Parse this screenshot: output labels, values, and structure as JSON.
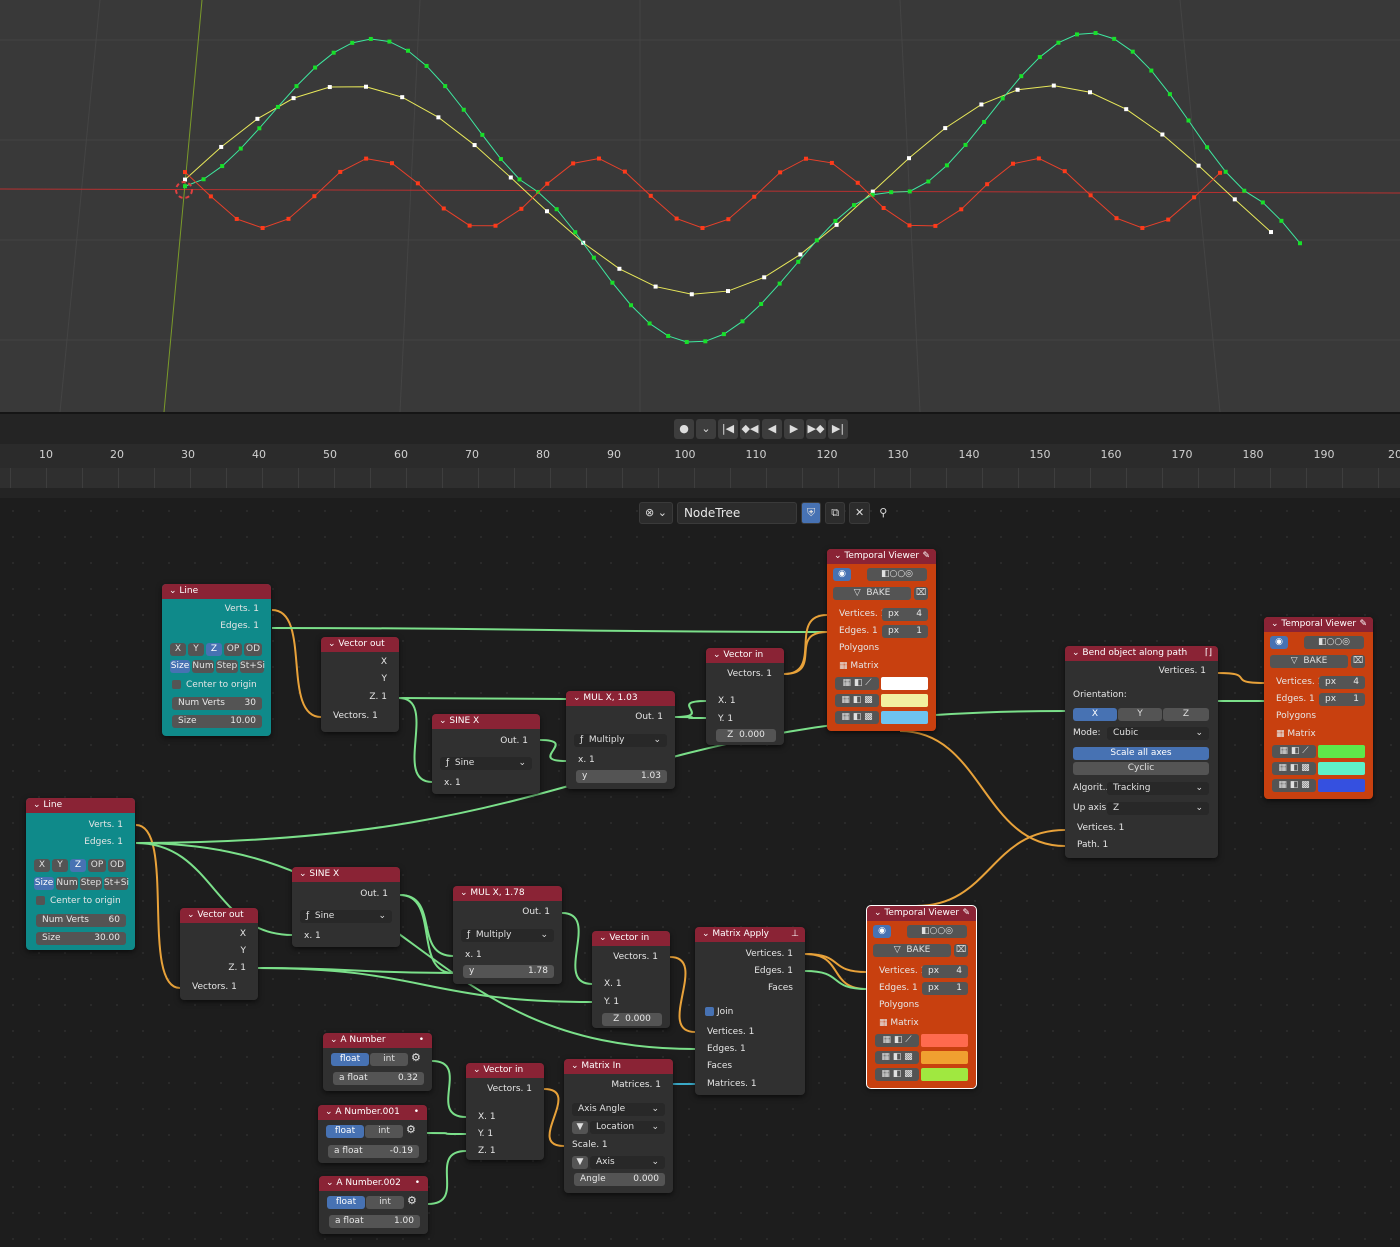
{
  "viewport": {
    "curves": {
      "white_color": "#e8e85a",
      "green_color": "#3ee8a0",
      "red_color": "#e8402a"
    }
  },
  "timeline": {
    "transport": [
      "●",
      "⌄",
      "|◀",
      "◆◀",
      "◀",
      "▶",
      "▶◆",
      "▶|"
    ],
    "frames": [
      "10",
      "20",
      "30",
      "40",
      "50",
      "60",
      "70",
      "80",
      "90",
      "100",
      "110",
      "120",
      "130",
      "140",
      "150",
      "160",
      "170",
      "180",
      "190",
      "20"
    ]
  },
  "node_header": {
    "editor_type": "⊗ ⌄",
    "tree_name": "NodeTree",
    "icons": [
      "shield-icon",
      "copy-icon",
      "close-icon",
      "pin-icon"
    ]
  },
  "nodes": {
    "line1": {
      "title": "Line",
      "verts": "Verts. 1",
      "edges": "Edges. 1",
      "modes": [
        "X",
        "Y",
        "Z",
        "OP",
        "OD"
      ],
      "mode_active": "Z",
      "kinds": [
        "Size",
        "Num",
        "Step",
        "St+Si"
      ],
      "center": "Center to origin",
      "num_verts_label": "Num Verts",
      "num_verts": "30",
      "size_label": "Size",
      "size": "10.00"
    },
    "line2": {
      "title": "Line",
      "verts": "Verts. 1",
      "edges": "Edges. 1",
      "modes": [
        "X",
        "Y",
        "Z",
        "OP",
        "OD"
      ],
      "mode_active": "Z",
      "kinds": [
        "Size",
        "Num",
        "Step",
        "St+Si"
      ],
      "center": "Center to origin",
      "num_verts_label": "Num Verts",
      "num_verts": "60",
      "size_label": "Size",
      "size": "30.00"
    },
    "vout1": {
      "title": "Vector out",
      "x": "X",
      "y": "Y",
      "z": "Z. 1",
      "vectors": "Vectors. 1"
    },
    "vout2": {
      "title": "Vector out",
      "x": "X",
      "y": "Y",
      "z": "Z. 1",
      "vectors": "Vectors. 1"
    },
    "sine1": {
      "title": "SINE X",
      "out": "Out. 1",
      "func": "Sine",
      "x": "x. 1"
    },
    "sine2": {
      "title": "SINE X",
      "out": "Out. 1",
      "func": "Sine",
      "x": "x. 1"
    },
    "mul1": {
      "title": "MUL X, 1.03",
      "out": "Out. 1",
      "func": "Multiply",
      "x": "x. 1",
      "y_label": "y",
      "y": "1.03"
    },
    "mul2": {
      "title": "MUL X, 1.78",
      "out": "Out. 1",
      "func": "Multiply",
      "x": "x. 1",
      "y_label": "y",
      "y": "1.78"
    },
    "vin1": {
      "title": "Vector in",
      "vectors": "Vectors. 1",
      "x": "X. 1",
      "y": "Y. 1",
      "z_label": "Z",
      "z": "0.000"
    },
    "vin2": {
      "title": "Vector in",
      "vectors": "Vectors. 1",
      "x": "X. 1",
      "y": "Y. 1",
      "z_label": "Z",
      "z": "0.000"
    },
    "vin3": {
      "title": "Vector in",
      "vectors": "Vectors. 1",
      "x": "X. 1",
      "y": "Y. 1",
      "z": "Z. 1"
    },
    "tv1": {
      "title": "Temporal Viewer",
      "bake": "BAKE",
      "vertices": "Vertices. 1",
      "edges": "Edges. 1",
      "polygons": "Polygons",
      "matrix": "Matrix",
      "px": "px",
      "vsize": "4",
      "esize": "1",
      "colors": [
        "#ffffff",
        "#f2f0a0",
        "#6ec3f0"
      ]
    },
    "tv2": {
      "title": "Temporal Viewer",
      "bake": "BAKE",
      "vertices": "Vertices. 1",
      "edges": "Edges. 1",
      "polygons": "Polygons",
      "matrix": "Matrix",
      "px": "px",
      "vsize": "4",
      "esize": "1",
      "colors": [
        "#5ee84a",
        "#5ef0c8",
        "#3550e0"
      ]
    },
    "tv3": {
      "title": "Temporal Viewer",
      "bake": "BAKE",
      "vertices": "Vertices. 1",
      "edges": "Edges. 1",
      "polygons": "Polygons",
      "matrix": "Matrix",
      "px": "px",
      "vsize": "4",
      "esize": "1",
      "colors": [
        "#ff6a4e",
        "#f0a030",
        "#a0e840"
      ]
    },
    "bend": {
      "title": "Bend object along path",
      "vertices_out": "Vertices. 1",
      "orientation": "Orientation:",
      "axes": [
        "X",
        "Y",
        "Z"
      ],
      "mode_label": "Mode:",
      "mode": "Cubic",
      "scale_all": "Scale all axes",
      "cyclic": "Cyclic",
      "algo_label": "Algorit...",
      "algo": "Tracking",
      "up_label": "Up axis:",
      "up": "Z",
      "vertices_in": "Vertices. 1",
      "path": "Path. 1"
    },
    "mapply": {
      "title": "Matrix Apply",
      "vertices_out": "Vertices. 1",
      "edges_out": "Edges. 1",
      "faces_out": "Faces",
      "join": "Join",
      "vertices_in": "Vertices. 1",
      "edges_in": "Edges. 1",
      "faces_in": "Faces",
      "matrices_in": "Matrices. 1"
    },
    "mtxin": {
      "title": "Matrix In",
      "matrices": "Matrices. 1",
      "mode": "Axis Angle",
      "location": "Location",
      "scale": "Scale. 1",
      "axis": "Axis",
      "angle_label": "Angle",
      "angle": "0.000"
    },
    "num1": {
      "title": "A Number",
      "float": "float",
      "int": "int",
      "label": "a float",
      "value": "0.32"
    },
    "num2": {
      "title": "A Number.001",
      "float": "float",
      "int": "int",
      "label": "a float",
      "value": "-0.19"
    },
    "num3": {
      "title": "A Number.002",
      "float": "float",
      "int": "int",
      "label": "a float",
      "value": "1.00"
    }
  }
}
